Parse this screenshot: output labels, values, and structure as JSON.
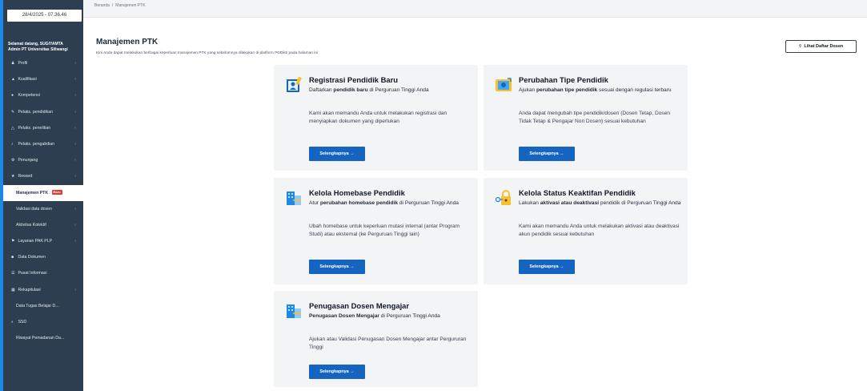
{
  "sidebar": {
    "clock": "28/4/2025 - 07.36.46",
    "greeting": "Selamat datang, SUGIYAMTA",
    "role": "Admin PT Universitas Siliwangi",
    "items": [
      {
        "label": "Profil",
        "icon": "person-icon",
        "chevron": true
      },
      {
        "label": "Kualifikasi",
        "icon": "graduation-cap-icon",
        "chevron": true
      },
      {
        "label": "Kompetensi",
        "icon": "users-icon",
        "chevron": true
      },
      {
        "label": "Pelaks. pendidikan",
        "icon": "pen-icon",
        "chevron": true
      },
      {
        "label": "Pelaks. penelitian",
        "icon": "flask-icon",
        "chevron": true
      },
      {
        "label": "Pelaks. pengabdian",
        "icon": "handshake-icon",
        "chevron": true
      },
      {
        "label": "Penunjang",
        "icon": "settings-icon",
        "chevron": true
      },
      {
        "label": "Reward",
        "icon": "trophy-icon",
        "chevron": true
      },
      {
        "label": "Manajemen PTK",
        "icon": "",
        "chevron": false,
        "badge": "Baru",
        "active": true
      },
      {
        "label": "Validasi data dosen",
        "icon": "",
        "chevron": true
      },
      {
        "label": "Aktivitas Kolektif",
        "icon": "",
        "chevron": true
      },
      {
        "label": "Layanan PAK PLP",
        "icon": "flag-icon",
        "chevron": true
      },
      {
        "label": "Data Dokumen",
        "icon": "folder-icon",
        "chevron": false
      },
      {
        "label": "Pusat Informasi",
        "icon": "list-icon",
        "chevron": false
      },
      {
        "label": "Rekapitulasi",
        "icon": "table-icon",
        "chevron": true
      },
      {
        "label": "Data Tugas Belajar D...",
        "icon": "",
        "chevron": false
      },
      {
        "label": "SSD",
        "icon": "toggle-icon",
        "chevron": false
      },
      {
        "label": "Riwayat Pemadanan Da...",
        "icon": "",
        "chevron": false
      }
    ]
  },
  "breadcrumb": {
    "home": "Beranda",
    "separator": "/",
    "current": "Manajemen PTK"
  },
  "header": {
    "title": "Manajemen PTK",
    "subtitle": "Kini Anda dapat melakukan berbagai keperluan manajemen PTK yang sebelumnya dilakukan di platform PDDikti pada halaman ini",
    "list_button": "Lihat Daftar Dosen"
  },
  "cards": [
    {
      "title": "Registrasi Pendidik Baru",
      "desc_pre": "Daftarkan ",
      "desc_bold": "pendidik baru",
      "desc_post": " di Perguruan Tinggi Anda",
      "body": "Kami akan memandu Anda untuk melakukan registrasi dan menyiapkan dokumen yang diperlukan",
      "button": "Selengkapnya →",
      "icon": "user-register-icon"
    },
    {
      "title": "Perubahan Tipe Pendidik",
      "desc_pre": "Ajukan ",
      "desc_bold": "perubahan tipe pendidik",
      "desc_post": " sesuai dengan regulasi terbaru",
      "body": "Anda dapat mengubah tipe pendidik/dosen (Dosen Tetap, Dosen Tidak Tetap & Pengajar Non Dosen) sesuai kebutuhan",
      "button": "Selengkapnya →",
      "icon": "id-card-change-icon"
    },
    {
      "title": "Kelola Homebase Pendidik",
      "desc_pre": "Atur ",
      "desc_bold": "perubahan homebase pendidik",
      "desc_post": " di Perguruan Tinggi Anda",
      "body": "Ubah homebase untuk keperluan mutasi internal (antar Program Studi) atau eksternal (ke Perguruan Tinggi lain)",
      "button": "Selengkapnya →",
      "icon": "building-transfer-icon"
    },
    {
      "title": "Kelola Status Keaktifan Pendidik",
      "desc_pre": "Lakukan ",
      "desc_bold": "aktivasi atau deaktivasi",
      "desc_post": " pendidik di Perguruan Tinggi Anda",
      "body": "Kami akan memandu Anda untuk melakukan aktivasi atau deaktivasi akun pendidik sesuai kebutuhan",
      "button": "Selengkapnya →",
      "icon": "lock-key-icon"
    },
    {
      "title": "Penugasan Dosen Mengajar",
      "desc_pre": "",
      "desc_bold": "Penugasan Dosen Mengajar",
      "desc_post": " di Perguruan Tinggi Anda",
      "body": "Ajukan atau Validasi Penugasan Dosen Mengajar antar Pergururan Tinggi",
      "button": "Selengkapnya →",
      "icon": "building-transfer-icon"
    }
  ]
}
